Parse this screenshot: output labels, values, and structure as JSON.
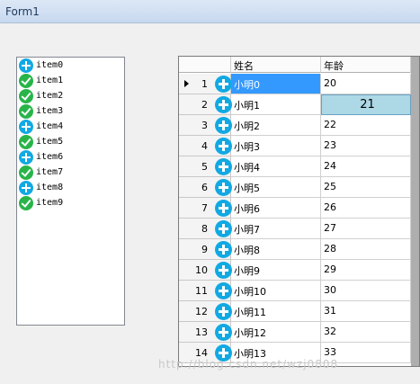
{
  "window": {
    "title": "Form1"
  },
  "listbox": {
    "items": [
      {
        "label": "item0",
        "icon": "add-icon"
      },
      {
        "label": "item1",
        "icon": "check-icon"
      },
      {
        "label": "item2",
        "icon": "check-icon"
      },
      {
        "label": "item3",
        "icon": "check-icon"
      },
      {
        "label": "item4",
        "icon": "add-icon"
      },
      {
        "label": "item5",
        "icon": "check-icon"
      },
      {
        "label": "item6",
        "icon": "add-icon"
      },
      {
        "label": "item7",
        "icon": "check-icon"
      },
      {
        "label": "item8",
        "icon": "add-icon"
      },
      {
        "label": "item9",
        "icon": "check-icon"
      }
    ]
  },
  "grid": {
    "columns": [
      "姓名",
      "年龄"
    ],
    "selected_row": 1,
    "editing_row": 2,
    "rows": [
      {
        "num": "1",
        "name": "小明0",
        "age": "20"
      },
      {
        "num": "2",
        "name": "小明1",
        "age": "21"
      },
      {
        "num": "3",
        "name": "小明2",
        "age": "22"
      },
      {
        "num": "4",
        "name": "小明3",
        "age": "23"
      },
      {
        "num": "5",
        "name": "小明4",
        "age": "24"
      },
      {
        "num": "6",
        "name": "小明5",
        "age": "25"
      },
      {
        "num": "7",
        "name": "小明6",
        "age": "26"
      },
      {
        "num": "8",
        "name": "小明7",
        "age": "27"
      },
      {
        "num": "9",
        "name": "小明8",
        "age": "28"
      },
      {
        "num": "10",
        "name": "小明9",
        "age": "29"
      },
      {
        "num": "11",
        "name": "小明10",
        "age": "30"
      },
      {
        "num": "12",
        "name": "小明11",
        "age": "31"
      },
      {
        "num": "13",
        "name": "小明12",
        "age": "32"
      },
      {
        "num": "14",
        "name": "小明13",
        "age": "33"
      }
    ]
  },
  "watermark": "http://blog.csdn.net/wzj0808",
  "colors": {
    "selection": "#3399ff",
    "edit_cell": "#add8e6",
    "add_icon": "#11a9e3",
    "check_icon": "#29b449"
  }
}
